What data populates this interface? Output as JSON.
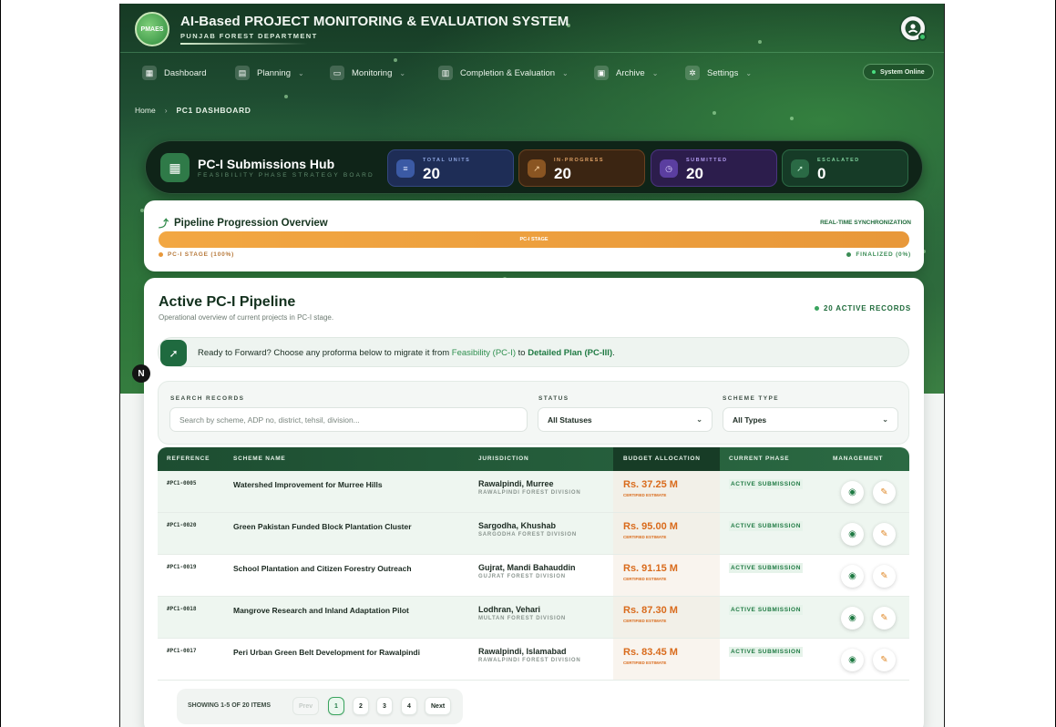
{
  "header": {
    "logo_text": "PMAES",
    "title": "AI-Based PROJECT MONITORING & EVALUATION SYSTEM",
    "subtitle": "PUNJAB FOREST DEPARTMENT"
  },
  "nav": {
    "items": [
      {
        "label": "Dashboard",
        "icon": "grid-icon"
      },
      {
        "label": "Planning",
        "icon": "calendar-icon"
      },
      {
        "label": "Monitoring",
        "icon": "monitor-icon"
      },
      {
        "label": "Completion & Evaluation",
        "icon": "chart-icon"
      },
      {
        "label": "Archive",
        "icon": "archive-icon"
      },
      {
        "label": "Settings",
        "icon": "gear-icon"
      }
    ],
    "status": "System Online"
  },
  "breadcrumb": {
    "home": "Home",
    "current": "PC1 DASHBOARD"
  },
  "hub": {
    "title": "PC-I Submissions Hub",
    "subtitle": "FEASIBILITY PHASE STRATEGY BOARD",
    "stats": [
      {
        "label": "TOTAL UNITS",
        "value": "20"
      },
      {
        "label": "IN-PROGRESS",
        "value": "20"
      },
      {
        "label": "SUBMITTED",
        "value": "20"
      },
      {
        "label": "ESCALATED",
        "value": "0"
      }
    ]
  },
  "overview": {
    "title": "Pipeline Progression Overview",
    "sync": "REAL-TIME SYNCHRONIZATION",
    "bar_label": "PC-I STAGE",
    "progress": 1.0,
    "left_label": "PC-I STAGE (100%)",
    "right_label": "FINALIZED (0%)",
    "colors": {
      "stage": "#e8983a",
      "finalized": "#3a8c55"
    }
  },
  "pipeline": {
    "title": "Active PC-I Pipeline",
    "subtitle": "Operational overview of current projects in PC-I stage.",
    "active_records": "20 ACTIVE RECORDS",
    "forward_prefix": "Ready to Forward? Choose any proforma below to migrate it from ",
    "forward_from": "Feasibility (PC-I)",
    "forward_mid": " to ",
    "forward_to": "Detailed Plan (PC-III)",
    "forward_suffix": "."
  },
  "filters": {
    "search_label": "SEARCH RECORDS",
    "search_placeholder": "Search by scheme, ADP no, district, tehsil, division...",
    "status_label": "STATUS",
    "status_value": "All Statuses",
    "type_label": "SCHEME TYPE",
    "type_value": "All Types"
  },
  "table": {
    "columns": [
      "REFERENCE",
      "SCHEME NAME",
      "JURISDICTION",
      "BUDGET ALLOCATION",
      "CURRENT PHASE",
      "MANAGEMENT"
    ],
    "rows": [
      {
        "ref": "#PC1-0005",
        "name": "Watershed Improvement for Murree Hills",
        "jurisdiction": "Rawalpindi, Murree",
        "division": "RAWALPINDI FOREST DIVISION",
        "budget": "Rs. 37.25 M",
        "cert": "CERTIFIED ESTIMATE",
        "phase": "ACTIVE SUBMISSION"
      },
      {
        "ref": "#PC1-0020",
        "name": "Green Pakistan Funded Block Plantation Cluster",
        "jurisdiction": "Sargodha, Khushab",
        "division": "SARGODHA FOREST DIVISION",
        "budget": "Rs. 95.00 M",
        "cert": "CERTIFIED ESTIMATE",
        "phase": "ACTIVE SUBMISSION"
      },
      {
        "ref": "#PC1-0019",
        "name": "School Plantation and Citizen Forestry Outreach",
        "jurisdiction": "Gujrat, Mandi Bahauddin",
        "division": "GUJRAT FOREST DIVISION",
        "budget": "Rs. 91.15 M",
        "cert": "CERTIFIED ESTIMATE",
        "phase": "ACTIVE SUBMISSION"
      },
      {
        "ref": "#PC1-0018",
        "name": "Mangrove Research and Inland Adaptation Pilot",
        "jurisdiction": "Lodhran, Vehari",
        "division": "MULTAN FOREST DIVISION",
        "budget": "Rs. 87.30 M",
        "cert": "CERTIFIED ESTIMATE",
        "phase": "ACTIVE SUBMISSION"
      },
      {
        "ref": "#PC1-0017",
        "name": "Peri Urban Green Belt Development for Rawalpindi",
        "jurisdiction": "Rawalpindi, Islamabad",
        "division": "RAWALPINDI FOREST DIVISION",
        "budget": "Rs. 83.45 M",
        "cert": "CERTIFIED ESTIMATE",
        "phase": "ACTIVE SUBMISSION"
      }
    ]
  },
  "pagination": {
    "info": "SHOWING 1-5 OF 20 ITEMS",
    "prev": "Prev",
    "pages": [
      "1",
      "2",
      "3",
      "4"
    ],
    "next": "Next"
  },
  "badge": "N"
}
